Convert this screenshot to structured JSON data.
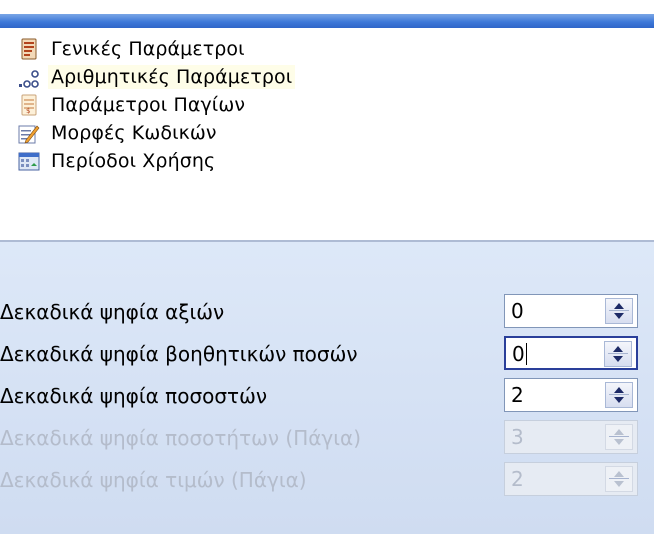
{
  "nav": {
    "items": [
      {
        "label": "Γενικές Παράμετροι",
        "icon": "general-params-icon",
        "selected": false
      },
      {
        "label": "Αριθμητικές Παράμετροι",
        "icon": "numeric-params-icon",
        "selected": true
      },
      {
        "label": "Παράμετροι Παγίων",
        "icon": "fixed-assets-params-icon",
        "selected": false
      },
      {
        "label": "Μορφές Κωδικών",
        "icon": "code-formats-icon",
        "selected": false
      },
      {
        "label": "Περίοδοι Χρήσης",
        "icon": "fiscal-periods-icon",
        "selected": false
      }
    ]
  },
  "settings": {
    "rows": [
      {
        "label": "Δεκαδικά ψηφία αξιών",
        "value": "0",
        "enabled": true
      },
      {
        "label": "Δεκαδικά ψηφία βοηθητικών ποσών",
        "value": "0",
        "enabled": true,
        "focused": true
      },
      {
        "label": "Δεκαδικά ψηφία ποσοστών",
        "value": "2",
        "enabled": true
      },
      {
        "label": "Δεκαδικά ψηφία ποσοτήτων (Πάγια)",
        "value": "3",
        "enabled": false
      },
      {
        "label": "Δεκαδικά ψηφία τιμών (Πάγια)",
        "value": "2",
        "enabled": false
      }
    ]
  },
  "colors": {
    "title_bar": "#3d78d8",
    "panel_bg": "#d6e2f5",
    "focus_border": "#2a3f9a",
    "disabled_text": "#b4bccb"
  }
}
